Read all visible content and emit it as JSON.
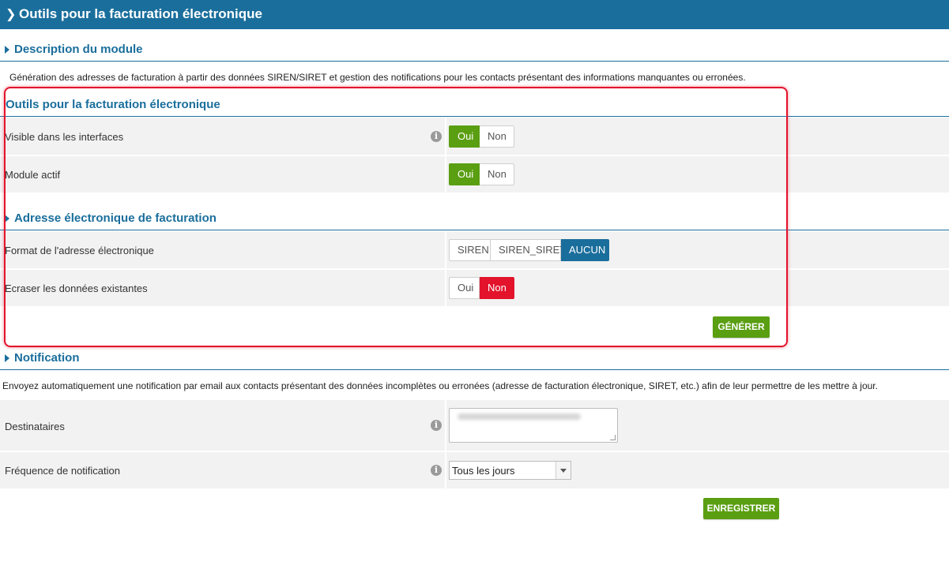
{
  "topbar": {
    "title": "Outils pour la facturation électronique"
  },
  "module_description": {
    "heading": "Description du module",
    "text": "Génération des adresses de facturation à partir des données SIREN/SIRET et gestion des notifications pour les contacts présentant des informations manquantes ou erronées."
  },
  "tools": {
    "heading": "Outils pour la facturation électronique",
    "visible": {
      "label": "Visible dans les interfaces",
      "yes": "Oui",
      "no": "Non",
      "selected": "Oui"
    },
    "active": {
      "label": "Module actif",
      "yes": "Oui",
      "no": "Non",
      "selected": "Oui"
    }
  },
  "billing_address": {
    "heading": "Adresse électronique de facturation",
    "format": {
      "label": "Format de l'adresse électronique",
      "options": [
        "SIREN",
        "SIREN_SIRET",
        "AUCUN"
      ],
      "selected": "AUCUN"
    },
    "overwrite": {
      "label": "Ecraser les données existantes",
      "yes": "Oui",
      "no": "Non",
      "selected": "Non"
    },
    "generate_button": "GÉNÉRER"
  },
  "notification": {
    "heading": "Notification",
    "text": "Envoyez automatiquement une notification par email aux contacts présentant des données incomplètes ou erronées (adresse de facturation électronique, SIRET, etc.) afin de leur permettre de les mettre à jour.",
    "recipients": {
      "label": "Destinataires"
    },
    "frequency": {
      "label": "Fréquence de notification",
      "value": "Tous les jours"
    },
    "save_button": "ENREGISTRER"
  },
  "colors": {
    "brand_blue": "#1a6e9c",
    "active_green": "#5a9e12",
    "alert_red": "#e3132c"
  }
}
